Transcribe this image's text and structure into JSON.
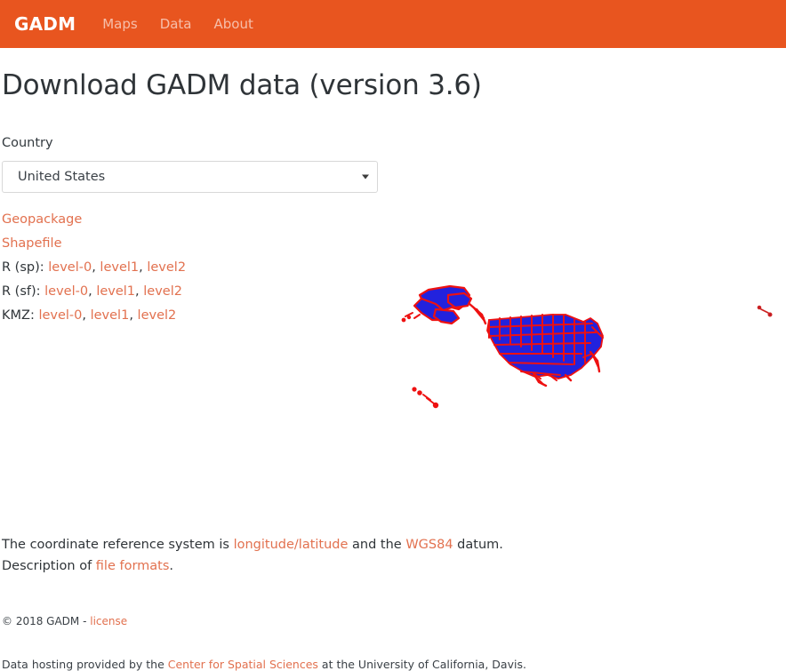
{
  "navbar": {
    "brand": "GADM",
    "links": [
      {
        "label": "Maps"
      },
      {
        "label": "Data"
      },
      {
        "label": "About"
      }
    ]
  },
  "main": {
    "title": "Download GADM data (version 3.6)",
    "country_label": "Country",
    "country_select": {
      "value": "United States",
      "arrow_icon": "chevron-down-icon"
    },
    "downloads": {
      "geopackage_label": "Geopackage",
      "shapefile_label": "Shapefile",
      "rsp_label": "R (sp):",
      "rsf_label": "R (sf):",
      "kmz_label": "KMZ:",
      "levels": [
        {
          "label": "level-0"
        },
        {
          "label": "level1"
        },
        {
          "label": "level2"
        }
      ],
      "separator": ", "
    },
    "map_thumbnail": {
      "name": "united-states-map-thumbnail",
      "fill_color": "#2222dd",
      "border_color": "#ee1111",
      "background_color": "#ffffff"
    },
    "crs": {
      "text_before": "The coordinate reference system is ",
      "link_crs": "longitude/latitude",
      "text_middle": " and the ",
      "link_datum": "WGS84",
      "text_after": " datum.",
      "description_before": "Description of ",
      "link_formats": "file formats",
      "description_after": "."
    }
  },
  "footer": {
    "copyright_text": "© 2018 GADM - ",
    "license_link": "license",
    "hosting_before": "Data hosting provided by the ",
    "hosting_link": "Center for Spatial Sciences",
    "hosting_after": " at the University of California, Davis."
  },
  "colors": {
    "navbar_bg": "#e8551f",
    "link": "#e2714f",
    "text": "#2f3438",
    "map_fill": "#2222dd",
    "map_border": "#ee1111"
  }
}
